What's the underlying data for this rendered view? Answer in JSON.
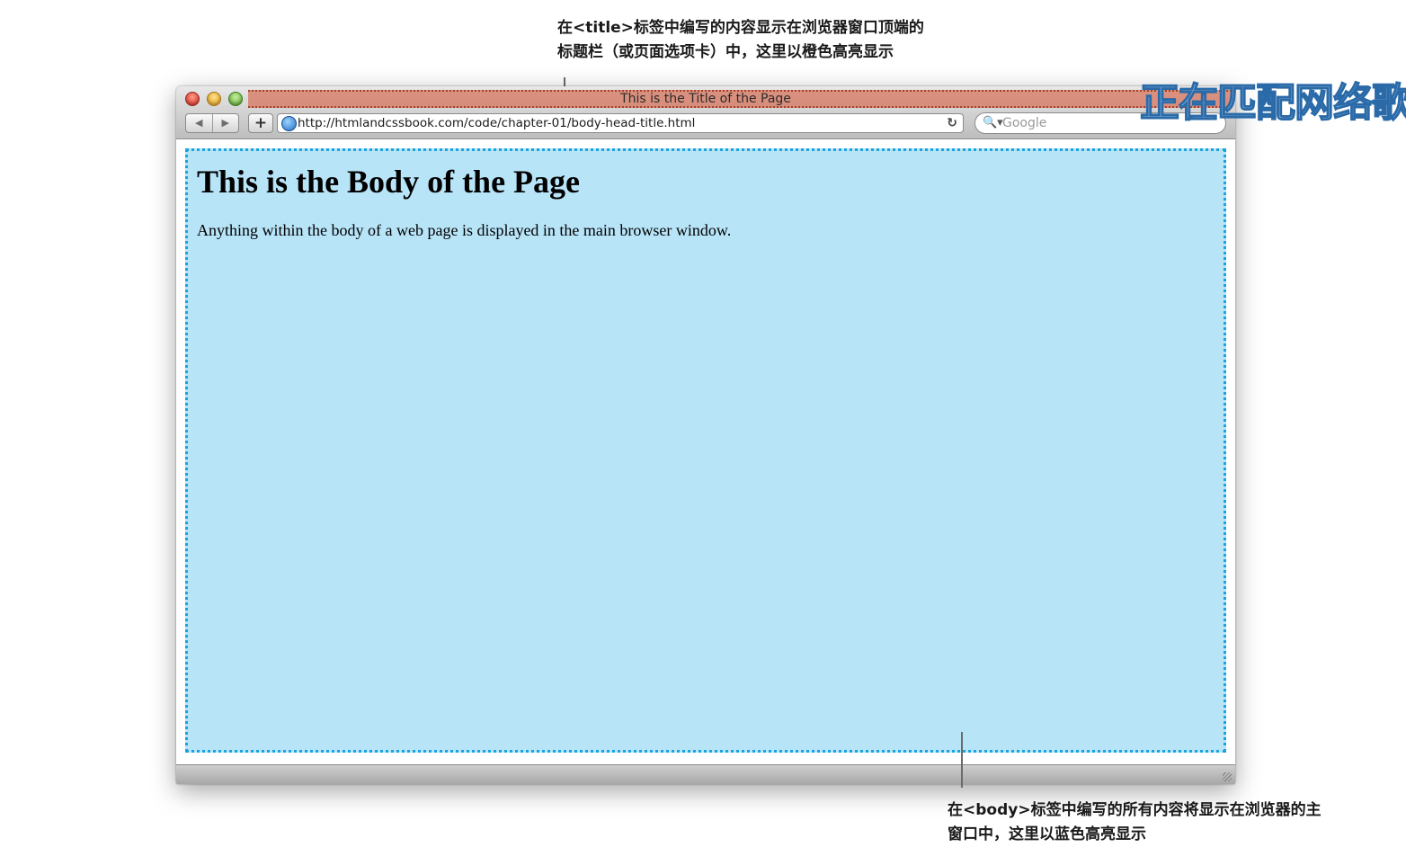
{
  "annotations": {
    "title_note": {
      "line1": "在<title>标签中编写的内容显示在浏览器窗口顶端的",
      "line2": "标题栏（或页面选项卡）中，这里以橙色高亮显示"
    },
    "body_note": {
      "line1": "在<body>标签中编写的所有内容将显示在浏览器的主",
      "line2": "窗口中，这里以蓝色高亮显示"
    }
  },
  "browser": {
    "window_title": "This is the Title of the Page",
    "nav": {
      "back_icon": "◀",
      "forward_icon": "▶"
    },
    "add_button": "+",
    "address": "http://htmlandcssbook.com/code/chapter-01/body-head-title.html",
    "reload_icon": "↻",
    "search": {
      "icon": "🔍▾",
      "placeholder": "Google"
    }
  },
  "overlay": {
    "watermark": "正在匹配网络歌"
  },
  "page": {
    "heading": "This is the Body of the Page",
    "paragraph": "Anything within the body of a web page is displayed in the main browser window."
  },
  "colors": {
    "title_highlight": "#d67058",
    "body_highlight": "#b8e4f8",
    "body_border": "#1ba3dd"
  }
}
